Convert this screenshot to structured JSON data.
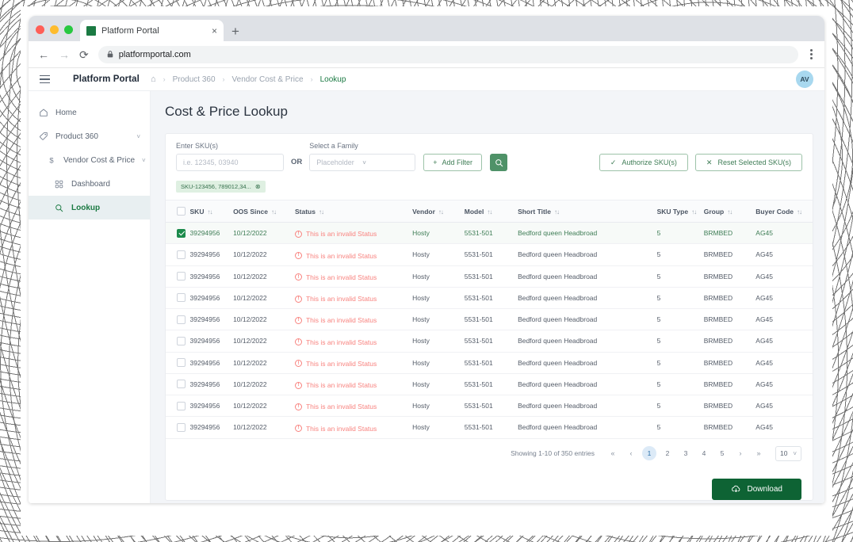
{
  "browser": {
    "tab_title": "Platform Portal",
    "tab_close": "×",
    "new_tab": "+",
    "back": "←",
    "forward": "→",
    "reload": "⟳",
    "lock": "🔒",
    "url": "platformportal.com"
  },
  "appbar": {
    "brand": "Platform Portal",
    "home_icon": "⌂",
    "breadcrumbs": [
      {
        "label": "Product 360",
        "active": false
      },
      {
        "label": "Vendor Cost  & Price",
        "active": false
      },
      {
        "label": "Lookup",
        "active": true
      }
    ],
    "separator": "›",
    "avatar_initials": "AV"
  },
  "sidebar": {
    "items": [
      {
        "label": "Home",
        "icon": "home-icon",
        "level": 1,
        "active": false,
        "chevron": false
      },
      {
        "label": "Product 360",
        "icon": "tag-icon",
        "level": 1,
        "active": false,
        "chevron": true
      },
      {
        "label": "Vendor Cost & Price",
        "icon": "dollar-icon",
        "level": 2,
        "active": false,
        "chevron": true
      },
      {
        "label": "Dashboard",
        "icon": "grid-icon",
        "level": 3,
        "active": false,
        "chevron": false
      },
      {
        "label": "Lookup",
        "icon": "search-icon",
        "level": 3,
        "active": true,
        "chevron": false
      }
    ]
  },
  "page": {
    "title": "Cost & Price Lookup"
  },
  "filters": {
    "sku_label": "Enter SKU(s)",
    "sku_placeholder": "i.e. 12345, 03940",
    "sku_value": "",
    "or": "OR",
    "family_label": "Select a Family",
    "family_value": "Placeholder",
    "add_filter": "Add Filter",
    "plus": "+",
    "chip": "SKU-123456, 789012,34...",
    "chip_close": "⊗",
    "authorize": "Authorize SKU(s)",
    "reset": "Reset Selected SKU(s)",
    "check": "✓",
    "cross": "✕"
  },
  "table": {
    "sort_glyph": "↑↓",
    "columns": [
      {
        "key": "sku",
        "label": "SKU",
        "sortable": true
      },
      {
        "key": "oos_since",
        "label": "OOS Since",
        "sortable": true
      },
      {
        "key": "status",
        "label": "Status",
        "sortable": true
      },
      {
        "key": "vendor",
        "label": "Vendor",
        "sortable": true
      },
      {
        "key": "model",
        "label": "Model",
        "sortable": true
      },
      {
        "key": "short_title",
        "label": "Short Title",
        "sortable": true
      },
      {
        "key": "sku_type",
        "label": "SKU Type",
        "sortable": true
      },
      {
        "key": "group",
        "label": "Group",
        "sortable": true
      },
      {
        "key": "buyer_code",
        "label": "Buyer Code",
        "sortable": true
      }
    ],
    "warn_glyph": "!",
    "rows": [
      {
        "selected": true,
        "sku": "39294956",
        "oos_since": "10/12/2022",
        "status": "This is an invalid Status",
        "vendor": "Hosty",
        "model": "5531-501",
        "short_title": "Bedford queen Headbroad",
        "sku_type": "5",
        "group": "BRMBED",
        "buyer_code": "AG45"
      },
      {
        "selected": false,
        "sku": "39294956",
        "oos_since": "10/12/2022",
        "status": "This is an invalid Status",
        "vendor": "Hosty",
        "model": "5531-501",
        "short_title": "Bedford queen Headbroad",
        "sku_type": "5",
        "group": "BRMBED",
        "buyer_code": "AG45"
      },
      {
        "selected": false,
        "sku": "39294956",
        "oos_since": "10/12/2022",
        "status": "This is an invalid Status",
        "vendor": "Hosty",
        "model": "5531-501",
        "short_title": "Bedford queen Headbroad",
        "sku_type": "5",
        "group": "BRMBED",
        "buyer_code": "AG45"
      },
      {
        "selected": false,
        "sku": "39294956",
        "oos_since": "10/12/2022",
        "status": "This is an invalid Status",
        "vendor": "Hosty",
        "model": "5531-501",
        "short_title": "Bedford queen Headbroad",
        "sku_type": "5",
        "group": "BRMBED",
        "buyer_code": "AG45"
      },
      {
        "selected": false,
        "sku": "39294956",
        "oos_since": "10/12/2022",
        "status": "This is an invalid Status",
        "vendor": "Hosty",
        "model": "5531-501",
        "short_title": "Bedford queen Headbroad",
        "sku_type": "5",
        "group": "BRMBED",
        "buyer_code": "AG45"
      },
      {
        "selected": false,
        "sku": "39294956",
        "oos_since": "10/12/2022",
        "status": "This is an invalid Status",
        "vendor": "Hosty",
        "model": "5531-501",
        "short_title": "Bedford queen Headbroad",
        "sku_type": "5",
        "group": "BRMBED",
        "buyer_code": "AG45"
      },
      {
        "selected": false,
        "sku": "39294956",
        "oos_since": "10/12/2022",
        "status": "This is an invalid Status",
        "vendor": "Hosty",
        "model": "5531-501",
        "short_title": "Bedford queen Headbroad",
        "sku_type": "5",
        "group": "BRMBED",
        "buyer_code": "AG45"
      },
      {
        "selected": false,
        "sku": "39294956",
        "oos_since": "10/12/2022",
        "status": "This is an invalid Status",
        "vendor": "Hosty",
        "model": "5531-501",
        "short_title": "Bedford queen Headbroad",
        "sku_type": "5",
        "group": "BRMBED",
        "buyer_code": "AG45"
      },
      {
        "selected": false,
        "sku": "39294956",
        "oos_since": "10/12/2022",
        "status": "This is an invalid Status",
        "vendor": "Hosty",
        "model": "5531-501",
        "short_title": "Bedford queen Headbroad",
        "sku_type": "5",
        "group": "BRMBED",
        "buyer_code": "AG45"
      },
      {
        "selected": false,
        "sku": "39294956",
        "oos_since": "10/12/2022",
        "status": "This is an invalid Status",
        "vendor": "Hosty",
        "model": "5531-501",
        "short_title": "Bedford queen Headbroad",
        "sku_type": "5",
        "group": "BRMBED",
        "buyer_code": "AG45"
      }
    ]
  },
  "pagination": {
    "showing": "Showing 1-10 of 350 entries",
    "first": "«",
    "prev": "‹",
    "next": "›",
    "last": "»",
    "pages": [
      "1",
      "2",
      "3",
      "4",
      "5"
    ],
    "current_page": "1",
    "page_size": "10",
    "page_size_chevron": "∨"
  },
  "footer": {
    "download": "Download"
  },
  "colors": {
    "brand_green": "#1b7a43",
    "download_green": "#0e6334",
    "search_green": "#4f9268",
    "status_red": "#f8837f",
    "page_active_blue": "#dceaf7",
    "avatar_blue": "#a8d8ef"
  }
}
